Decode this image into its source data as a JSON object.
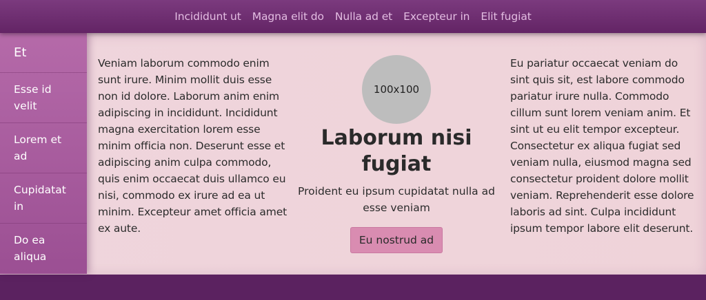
{
  "nav": {
    "links": [
      "Incididunt ut",
      "Magna elit do",
      "Nulla ad et",
      "Excepteur in",
      "Elit fugiat"
    ]
  },
  "sidebar": {
    "brand": "Et",
    "items": [
      {
        "label": "Esse id velit"
      },
      {
        "label": "Lorem et ad"
      },
      {
        "label": "Cupidatat in"
      },
      {
        "label": "Do ea aliqua"
      }
    ]
  },
  "main": {
    "left_text": "Veniam laborum commodo enim sunt irure. Minim mollit duis esse non id dolore. Laborum anim enim adipiscing in incididunt. Incididunt magna exercitation lorem esse minim officia non. Deserunt esse et adipiscing anim culpa commodo, quis enim occaecat duis ullamco eu nisi, commodo ex irure ad ea ut minim. Excepteur amet officia amet ex aute.",
    "avatar_label": "100x100",
    "heading": "Laborum nisi fugiat",
    "subtext": "Proident eu ipsum cupidatat nulla ad esse veniam",
    "button_label": "Eu nostrud ad",
    "right_text": "Eu pariatur occaecat veniam do sint quis sit, est labore commodo pariatur irure nulla. Commodo cillum sunt lorem veniam anim. Et sint ut eu elit tempor excepteur. Consectetur ex aliqua fugiat sed veniam nulla, eiusmod magna sed consectetur proident dolore mollit veniam. Reprehenderit esse dolore laboris ad sint. Culpa incididunt ipsum tempor labore elit deserunt."
  },
  "colors": {
    "topbar": "#6e2d71",
    "background": "#5b2260",
    "panel": "#efd4da",
    "sidebar": "#a95c9e",
    "button": "#d98cb1",
    "avatar": "#bdbdbd"
  }
}
